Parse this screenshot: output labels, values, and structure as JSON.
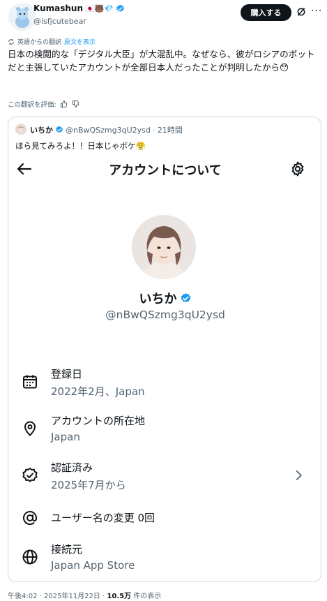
{
  "post": {
    "author_name": "Kumashun",
    "author_emojis": "🇯🇵🐻💎",
    "author_handle": "@isfjcutebear",
    "buy_label": "購入する",
    "more_label": "···",
    "translation_notice": "英語からの翻訳",
    "show_original_label": "原文を表示",
    "body": "日本の検閲的な「デジタル大臣」が大混乱中。なぜなら、彼がロシアのボットだと主張していたアカウントが全部日本人だったことが判明したから😯",
    "rate_translation_label": "この翻訳を評価:",
    "timestamp": "午後4:02 · 2025年11月22日 · ",
    "views_count": "10.5万",
    "views_label": " 件の表示"
  },
  "quote": {
    "name": "いちか",
    "handle": "@nBwQSzmg3qU2ysd",
    "time": "· 21時間",
    "text": "ほら見てみろよ！！日本じゃボケ😤",
    "screen_title": "アカウントについて",
    "profile_name": "いちか",
    "profile_handle": "@nBwQSzmg3qU2ysd",
    "rows": [
      {
        "label": "登録日",
        "value": "2022年2月、Japan",
        "icon": "calendar-icon"
      },
      {
        "label": "アカウントの所在地",
        "value": "Japan",
        "icon": "location-pin-icon"
      },
      {
        "label": "認証済み",
        "value": "2025年7月から",
        "icon": "verified-badge-outline-icon"
      },
      {
        "label": "ユーザー名の変更 0回",
        "value": "",
        "icon": "at-sign-icon"
      },
      {
        "label": "接続元",
        "value": "Japan App Store",
        "icon": "globe-icon"
      }
    ]
  },
  "colors": {
    "accent": "#1d9bf0",
    "text_primary": "#0f1419",
    "text_secondary": "#536471",
    "border": "#cfd9de"
  }
}
